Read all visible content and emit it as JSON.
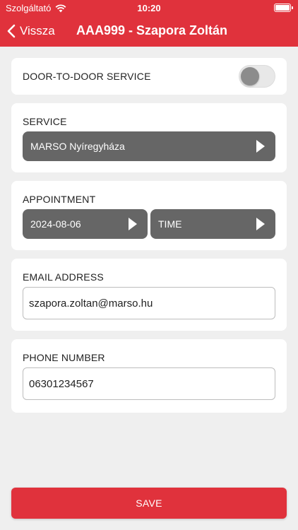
{
  "status_bar": {
    "carrier": "Szolgáltató",
    "time": "10:20"
  },
  "nav": {
    "back_label": "Vissza",
    "title": "AAA999 - Szapora Zoltán"
  },
  "door_to_door": {
    "label": "DOOR-TO-DOOR SERVICE",
    "enabled": false
  },
  "service": {
    "label": "SERVICE",
    "selected": "MARSO Nyíregyháza"
  },
  "appointment": {
    "label": "APPOINTMENT",
    "date": "2024-08-06",
    "time": "TIME"
  },
  "email": {
    "label": "EMAIL ADDRESS",
    "value": "szapora.zoltan@marso.hu"
  },
  "phone": {
    "label": "PHONE NUMBER",
    "value": "06301234567"
  },
  "save_label": "SAVE",
  "colors": {
    "accent": "#e0323c",
    "selector_bg": "#666666",
    "background": "#efefef"
  }
}
